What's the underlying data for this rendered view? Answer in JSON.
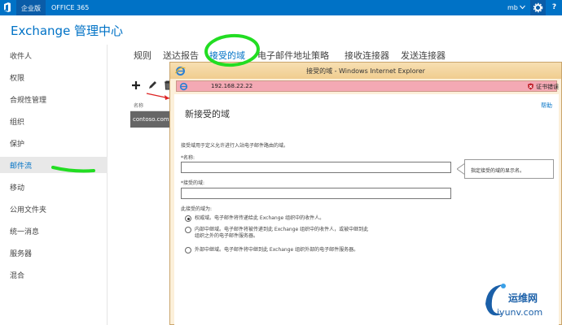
{
  "topbar": {
    "tab_enterprise": "企业版",
    "tab_office365": "OFFICE 365",
    "user": "mb",
    "help": "?"
  },
  "page_title": "Exchange 管理中心",
  "leftnav": {
    "items": [
      {
        "label": "收件人"
      },
      {
        "label": "权限"
      },
      {
        "label": "合规性管理"
      },
      {
        "label": "组织"
      },
      {
        "label": "保护"
      },
      {
        "label": "邮件流"
      },
      {
        "label": "移动"
      },
      {
        "label": "公用文件夹"
      },
      {
        "label": "统一消息"
      },
      {
        "label": "服务器"
      },
      {
        "label": "混合"
      }
    ],
    "active_index": 5
  },
  "subtabs": [
    {
      "label": "规则"
    },
    {
      "label": "送达报告"
    },
    {
      "label": "接受的域"
    },
    {
      "label": "电子邮件地址策略"
    },
    {
      "label": "接收连接器"
    },
    {
      "label": "发送连接器"
    }
  ],
  "list": {
    "column_header": "名称",
    "selected_row": "contoso.com"
  },
  "ie_window": {
    "title": "接受的域 - Windows Internet Explorer",
    "address": "192.168.22.22",
    "cert_error": "证书错误"
  },
  "dialog": {
    "help": "帮助",
    "title": "新接受的域",
    "description": "接受域用于定义允许进行入站电子邮件路由的域。",
    "name_label": "*名称:",
    "name_value": "",
    "accepted_domain_label": "*接受的域:",
    "accepted_domain_value": "",
    "domain_type_label": "此接受的域为:",
    "radios": [
      {
        "line1": "权威域。电子邮件将传递给此 Exchange 组织中的收件人。",
        "line2": "",
        "checked": true
      },
      {
        "line1": "内部中继域。电子邮件将被传递到此 Exchange 组织中的收件人，或被中继到此",
        "line2": "组织之外的电子邮件服务器。",
        "checked": false
      },
      {
        "line1": "外部中继域。电子邮件将中继到此 Exchange 组织外部的电子邮件服务器。",
        "line2": "",
        "checked": false
      }
    ]
  },
  "tooltip": "指定接受的域的显示名。",
  "watermark": {
    "brand": "运维网",
    "url": "iyunv.com"
  },
  "colors": {
    "brand_blue": "#0072c6",
    "highlight_green": "#22dd22",
    "arrow_red": "#dd2222",
    "cert_error_bar": "#f4a9b4"
  }
}
